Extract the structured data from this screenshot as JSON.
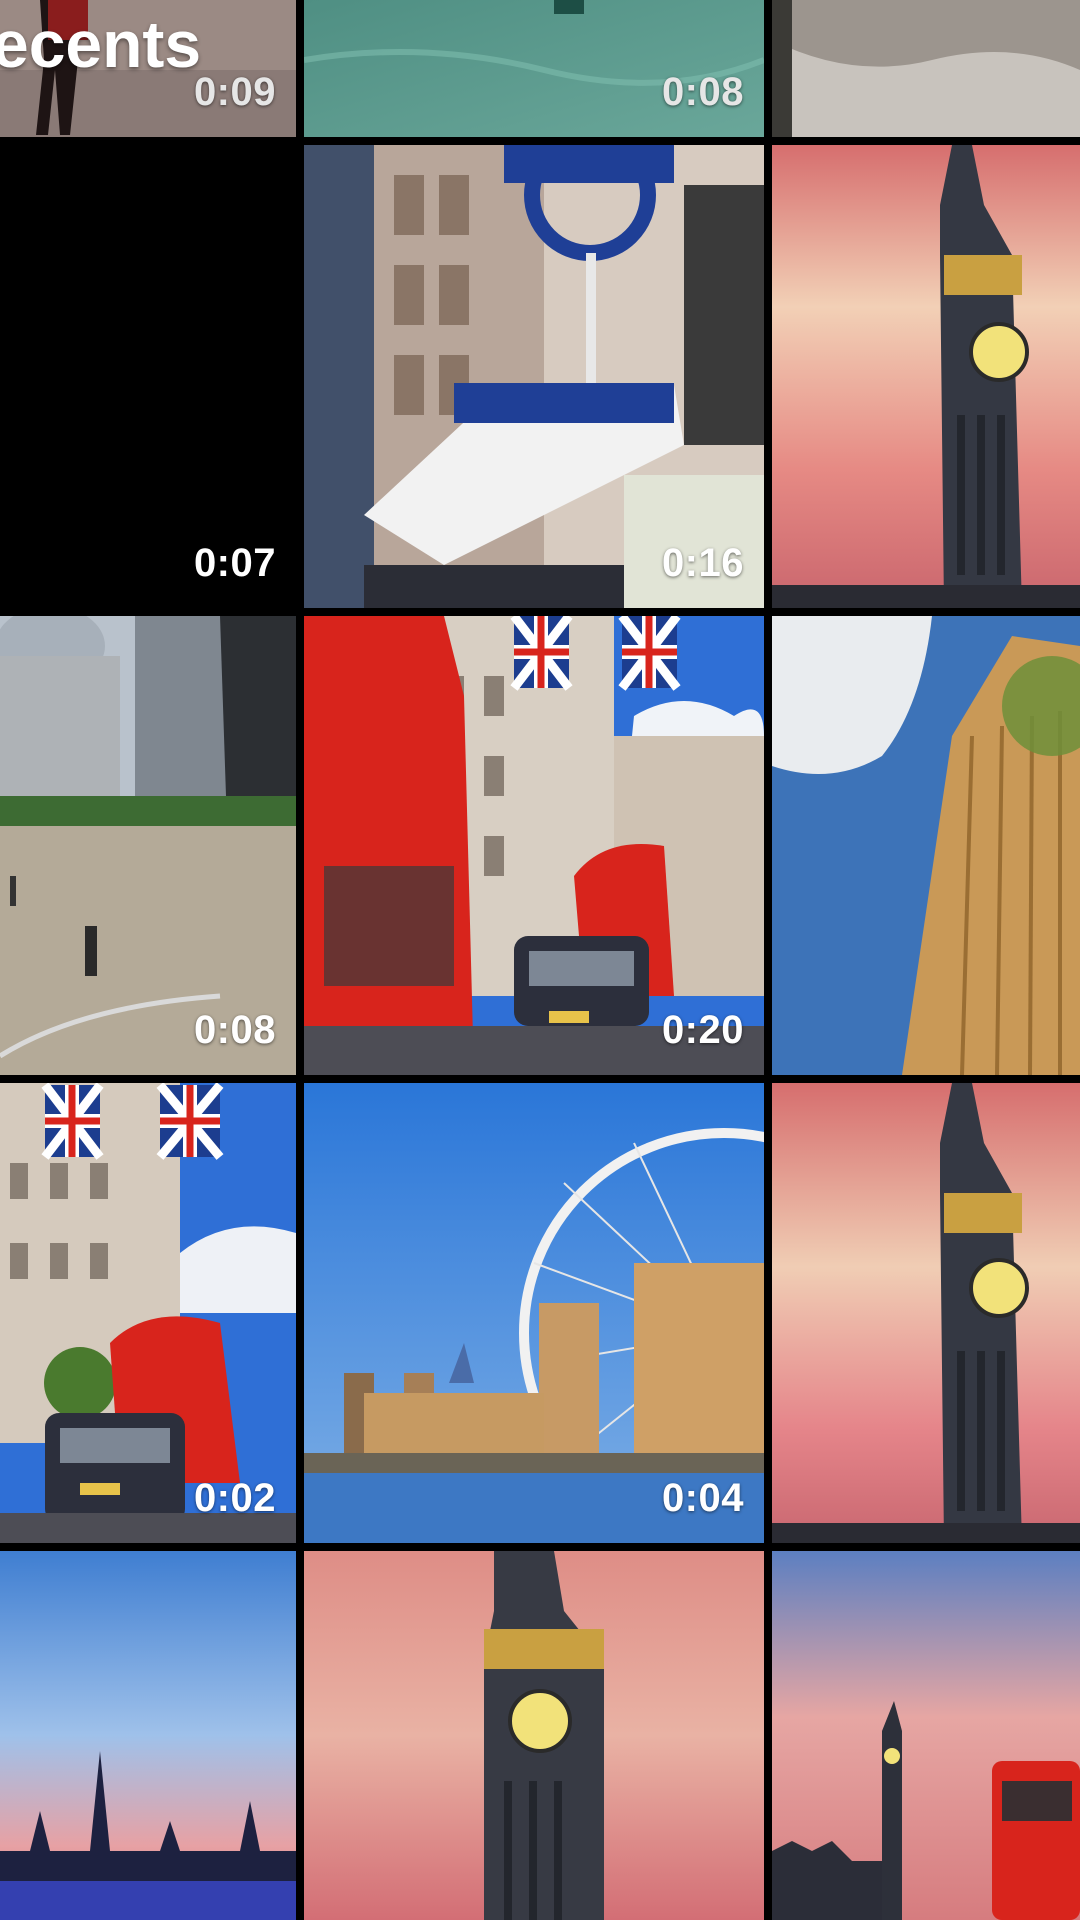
{
  "header": {
    "title": "ecents"
  },
  "grid": {
    "items": [
      {
        "name": "runner-path",
        "duration": "0:09"
      },
      {
        "name": "water-closeup",
        "duration": "0:08"
      },
      {
        "name": "stone-closeup",
        "duration": ""
      },
      {
        "name": "black-clip",
        "duration": "0:07"
      },
      {
        "name": "burberry-street",
        "duration": "0:16"
      },
      {
        "name": "big-ben-sunset",
        "duration": ""
      },
      {
        "name": "st-pauls-street",
        "duration": "0:08"
      },
      {
        "name": "red-bus-flags",
        "duration": "0:20"
      },
      {
        "name": "tower-low-angle",
        "duration": ""
      },
      {
        "name": "bus-taxi-street",
        "duration": "0:02"
      },
      {
        "name": "london-eye",
        "duration": "0:04"
      },
      {
        "name": "big-ben-dusk",
        "duration": ""
      },
      {
        "name": "westminster-skyline",
        "duration": ""
      },
      {
        "name": "big-ben-clock",
        "duration": ""
      },
      {
        "name": "big-ben-bus",
        "duration": ""
      }
    ]
  },
  "colors": {
    "background": "#000000",
    "bus_red": "#d8241c",
    "sky_blue": "#2f6fd6",
    "sunset_pink": "#e58b8e",
    "clock_yellow": "#f2e27a"
  }
}
